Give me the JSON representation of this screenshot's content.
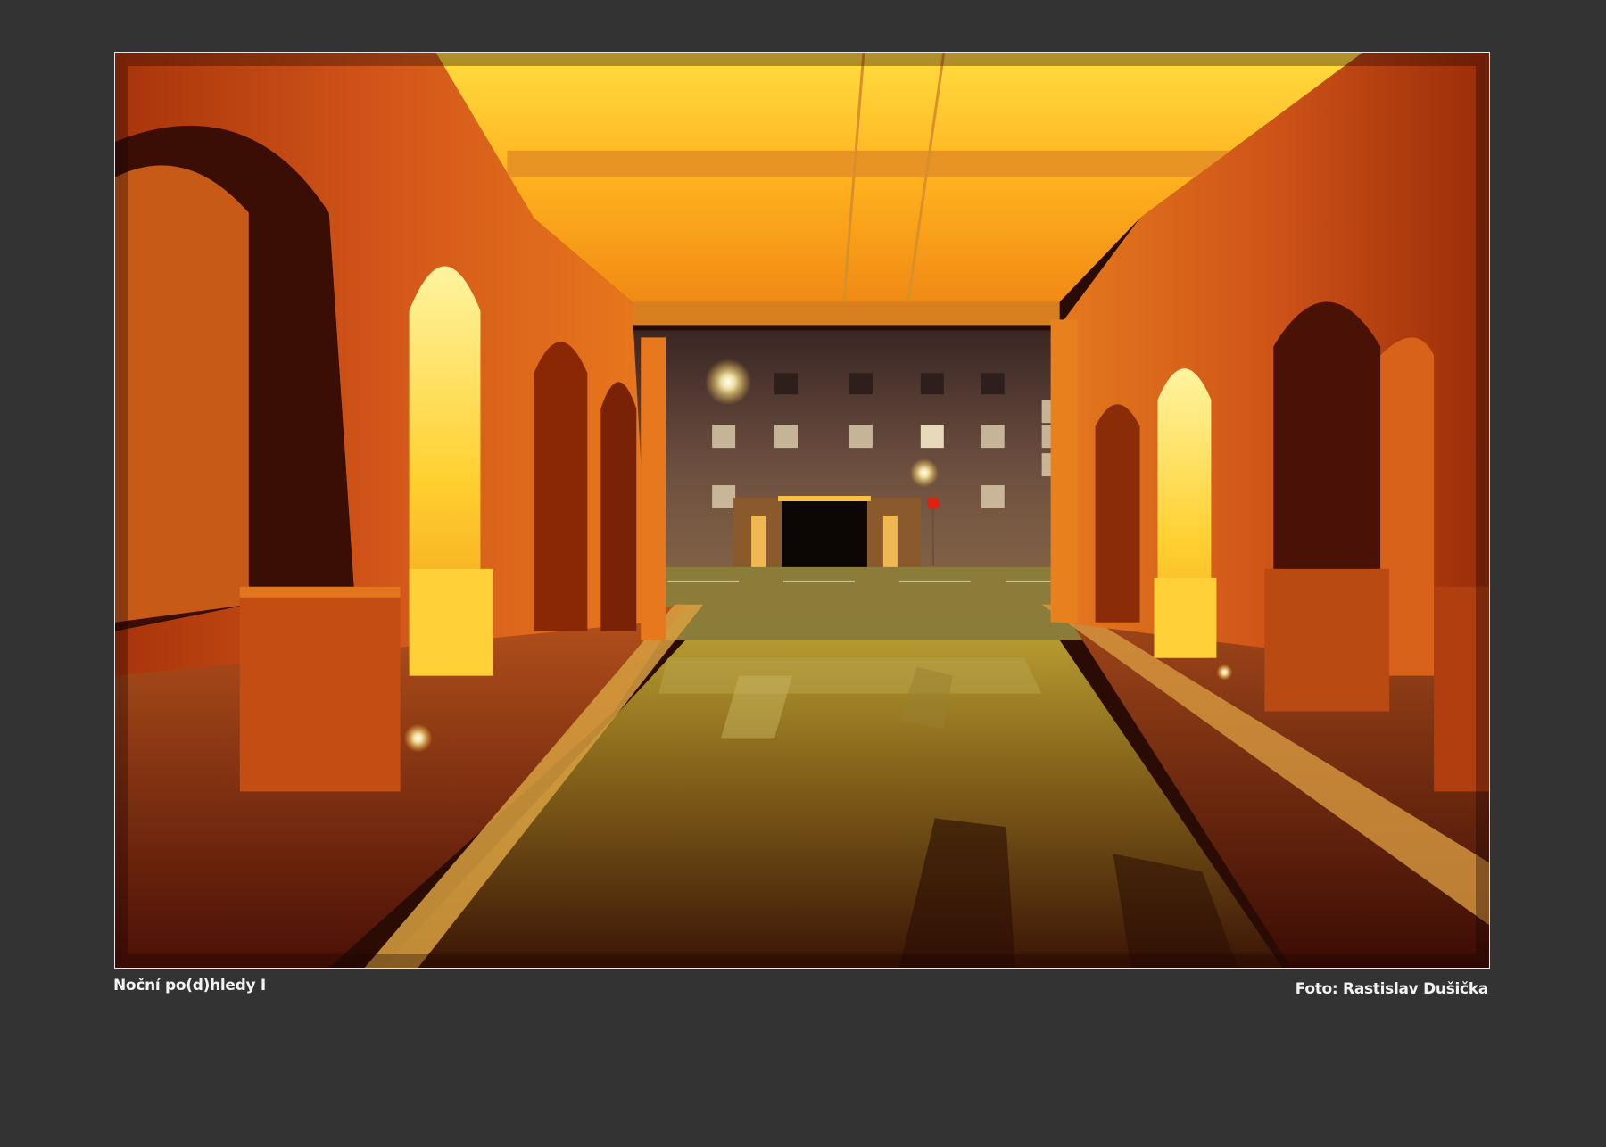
{
  "gallery": {
    "photo_title": "Noční po(d)hledy I",
    "photo_credit": "Foto: Rastislav Dušička",
    "background_color": "#333333",
    "frame_color": "#e8e8e8"
  },
  "photo": {
    "scene": "night-arcade-underpass",
    "palette": {
      "ceiling_light": "#ffd23a",
      "wall_orange": "#e36a10",
      "deep_shadow": "#3a0d04",
      "lamp_glow": "#fff6c8",
      "building_facade": "#6e4a3a"
    }
  }
}
